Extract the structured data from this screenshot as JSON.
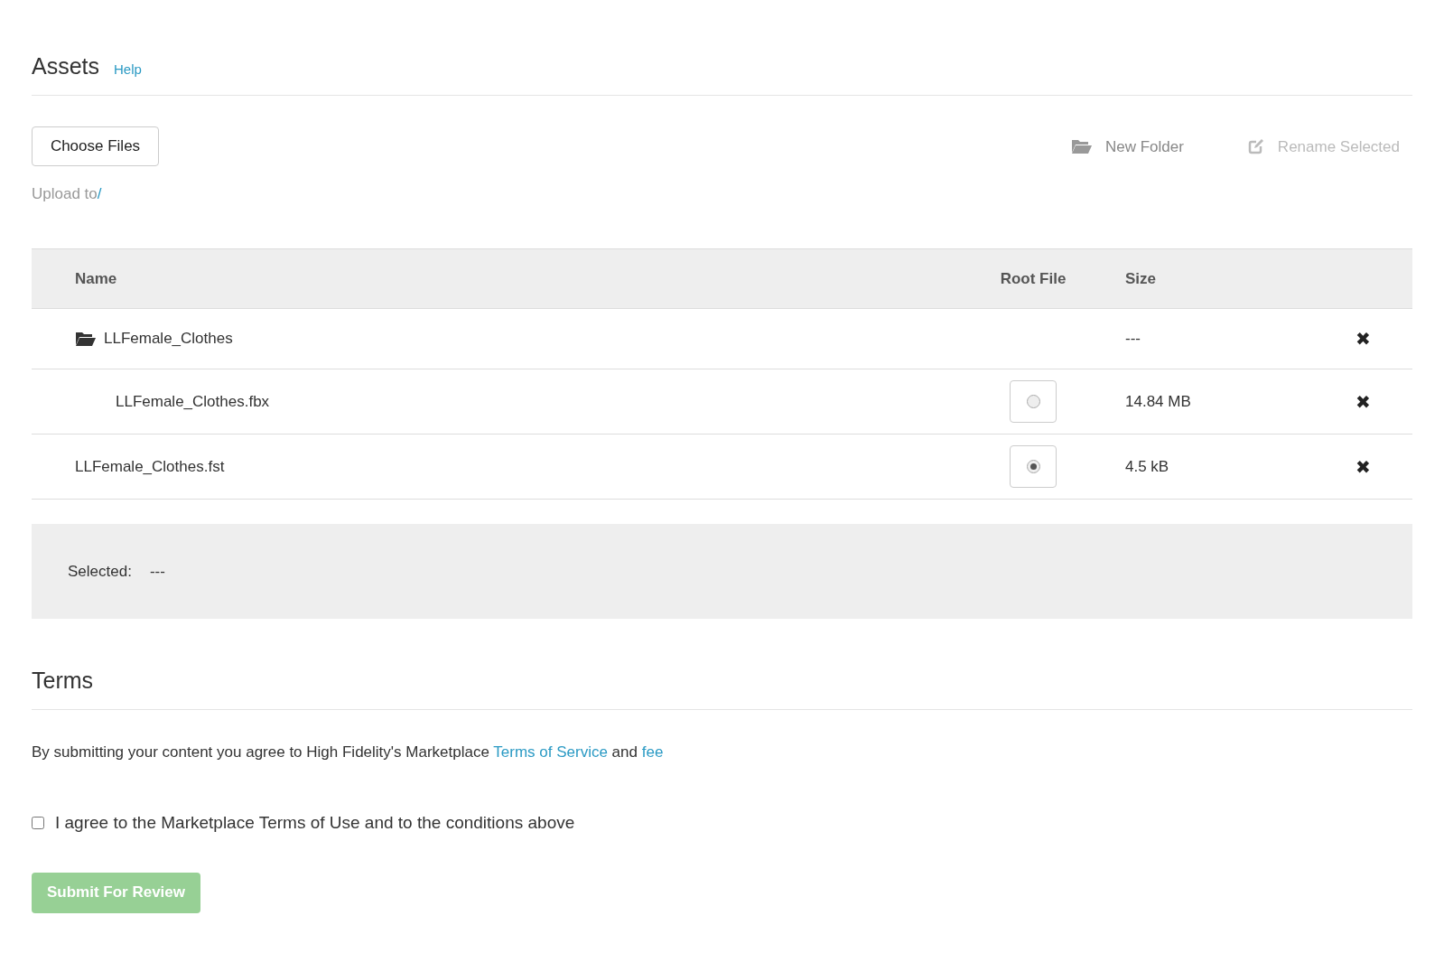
{
  "assets": {
    "title": "Assets",
    "help_link": "Help"
  },
  "toolbar": {
    "choose_files": "Choose Files",
    "upload_to": {
      "label": "Upload to",
      "path": "/"
    },
    "actions": [
      {
        "kind": "folder",
        "label": "New Folder",
        "disabled": false
      },
      {
        "kind": "rename",
        "label": "Rename Selected",
        "disabled": true
      }
    ]
  },
  "table": {
    "columns": [
      "Name",
      "Root File",
      "Size"
    ],
    "rows": [
      {
        "kind": "folder",
        "name": "LLFemale_Clothes",
        "size": "---",
        "remove": "✖",
        "children": [
          {
            "kind": "file",
            "name": "LLFemale_Clothes.fbx",
            "size": "14.84 MB",
            "remove": "✖",
            "selected": false
          }
        ]
      },
      {
        "kind": "file",
        "name": "LLFemale_Clothes.fst",
        "size": "4.5 kB",
        "remove": "✖",
        "selected": true
      }
    ]
  },
  "selection": {
    "label": "Selected:",
    "value": "---"
  },
  "terms": {
    "title": "Terms",
    "text": "By submitting your content you agree to High Fidelity's Marketplace",
    "link_1": "Terms of Service",
    "and": "and",
    "link_2": "fee",
    "agree": {
      "label": "I agree to the Marketplace Terms of Use and to the conditions above",
      "checked": false
    },
    "submit": {
      "label": "Submit For Review",
      "disabled": true
    }
  }
}
